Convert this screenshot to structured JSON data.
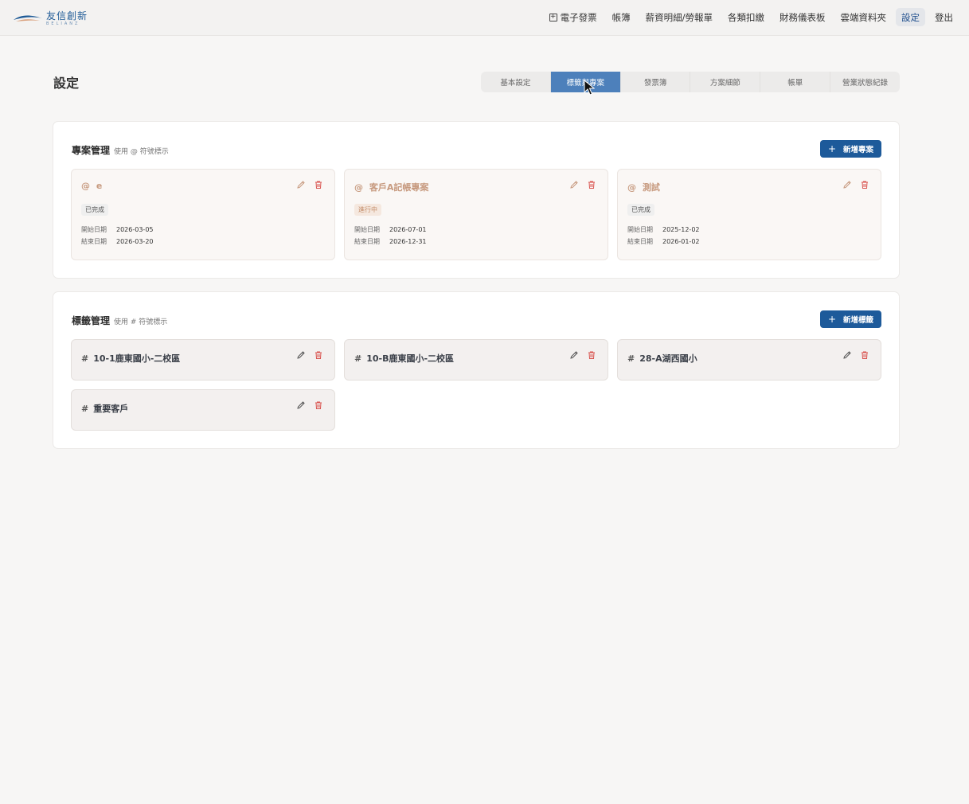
{
  "brand": {
    "name_cn": "友信創新",
    "name_en": "BELIANZ"
  },
  "nav": {
    "items": [
      {
        "label": "電子發票",
        "icon": "plus-square-icon"
      },
      {
        "label": "帳簿"
      },
      {
        "label": "薪資明細/勞報單"
      },
      {
        "label": "各類扣繳"
      },
      {
        "label": "財務儀表板"
      },
      {
        "label": "雲端資料夾"
      },
      {
        "label": "設定",
        "active": true
      },
      {
        "label": "登出"
      }
    ]
  },
  "page": {
    "title": "設定"
  },
  "tabs": [
    {
      "label": "基本設定"
    },
    {
      "label": "標籤與專案",
      "active": true
    },
    {
      "label": "發票簿"
    },
    {
      "label": "方案細節"
    },
    {
      "label": "帳單"
    },
    {
      "label": "營業狀態紀錄"
    }
  ],
  "projects": {
    "title": "專案管理",
    "hint": "使用 @ 符號標示",
    "add_label": "新增專案",
    "start_label": "開始日期",
    "end_label": "結束日期",
    "items": [
      {
        "prefix": "@",
        "name": "e",
        "status": "已完成",
        "status_type": "done",
        "start": "2026-03-05",
        "end": "2026-03-20"
      },
      {
        "prefix": "@",
        "name": "客戶A記帳專案",
        "status": "進行中",
        "status_type": "ongoing",
        "start": "2026-07-01",
        "end": "2026-12-31"
      },
      {
        "prefix": "@",
        "name": "測試",
        "status": "已完成",
        "status_type": "done",
        "start": "2025-12-02",
        "end": "2026-01-02"
      }
    ]
  },
  "tags": {
    "title": "標籤管理",
    "hint": "使用 # 符號標示",
    "add_label": "新增標籤",
    "items": [
      {
        "prefix": "#",
        "name": "10-1鹿東國小-二校區"
      },
      {
        "prefix": "#",
        "name": "10-B鹿東國小-二校區"
      },
      {
        "prefix": "#",
        "name": "28-A湖西國小"
      },
      {
        "prefix": "#",
        "name": "重要客戶"
      }
    ]
  },
  "colors": {
    "accent": "#1d5a9a",
    "tab_active": "#4d80bb",
    "project_title": "#c79a7f",
    "delete_icon": "#d9534f"
  }
}
